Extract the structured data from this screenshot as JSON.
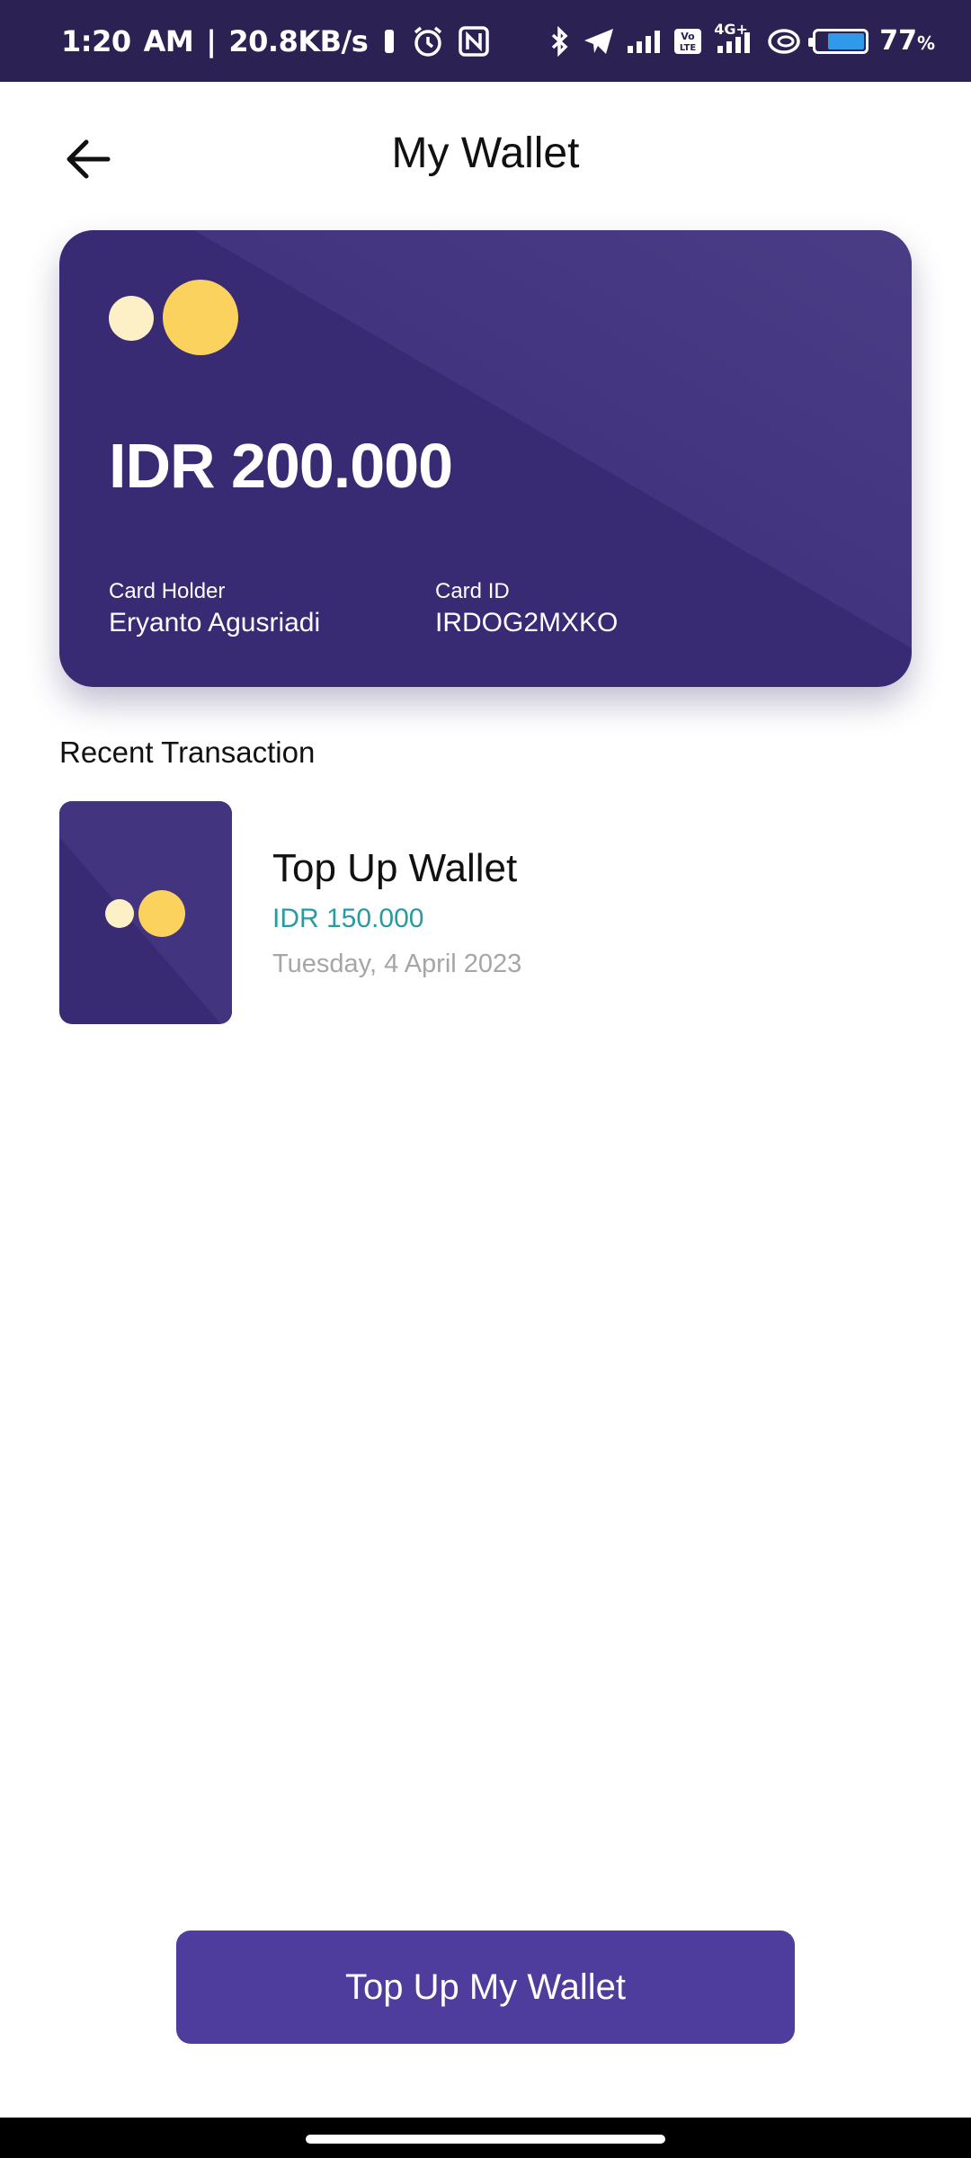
{
  "status_bar": {
    "time": "1:20",
    "ampm": "AM",
    "separator": "|",
    "net_speed": "20.8KB/s",
    "network_badge": "4G+",
    "volte_badge": "Vo LTE",
    "battery_percent": "77",
    "battery_unit": "%",
    "battery_level": 0.77,
    "battery_color": "#2f9be8",
    "icons": [
      "vibrate-icon",
      "alarm-icon",
      "nfc-icon",
      "bluetooth-icon",
      "telegram-icon",
      "signal-icon",
      "volte-icon",
      "signal-4g-icon",
      "hotspot-icon",
      "battery-icon"
    ]
  },
  "header": {
    "title": "My Wallet",
    "back_icon": "arrow-left-icon"
  },
  "card": {
    "balance": "IDR 200.000",
    "holder_label": "Card Holder",
    "holder_name": "Eryanto Agusriadi",
    "id_label": "Card ID",
    "id_value": "IRDOG2MXKO",
    "colors": {
      "background": "#382a73",
      "dot_light": "#fdefc6",
      "dot_yellow": "#fcd25e"
    }
  },
  "recent": {
    "title": "Recent Transaction",
    "items": [
      {
        "title": "Top Up Wallet",
        "amount": "IDR 150.000",
        "date": "Tuesday, 4 April 2023"
      }
    ],
    "amount_color": "#2a9aa0"
  },
  "actions": {
    "topup_label": "Top Up My Wallet",
    "button_color": "#4e3d9c"
  }
}
